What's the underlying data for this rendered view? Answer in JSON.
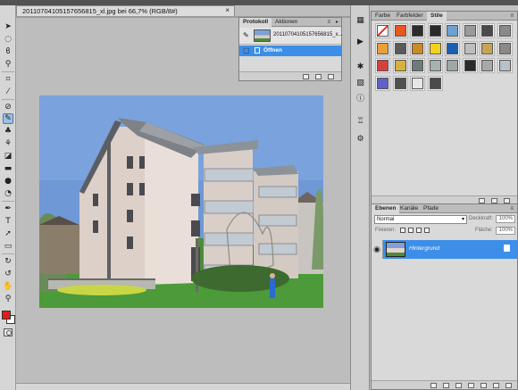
{
  "document": {
    "tab_title": "20110704105157656815_xl.jpg bei 66,7% (RGB/8#)",
    "close_glyph": "×"
  },
  "history_panel": {
    "tabs": [
      "Protokoll",
      "Aktionen"
    ],
    "snapshot_label": "20110704105157656815_x...",
    "state_label": "Öffnen"
  },
  "styles_panel": {
    "tabs": [
      "Farbe",
      "Farbfelder",
      "Stile"
    ],
    "swatch_colors": [
      "#f4f4f4",
      "#e8571e",
      "#2c2c2c",
      "#2a2a2a",
      "#6fa0d2",
      "#9a9a9a",
      "#4a4a4a",
      "#8a8a8a",
      "#e9a03a",
      "#5a5a5a",
      "#c98b25",
      "#f2d21a",
      "#1c5fb1",
      "#bdbdbd",
      "#c7a455",
      "#8a8a8a",
      "#d84040",
      "#d8b040",
      "#6f7a7a",
      "#a6b2b2",
      "#9ea8a8",
      "#2a2a2a",
      "#a8a8a8",
      "#b8c0c8",
      "#6060c8",
      "#505050",
      "#e6e6e6",
      "#4a4a4a"
    ]
  },
  "layers_panel": {
    "tabs": [
      "Ebenen",
      "Kanäle",
      "Pfade"
    ],
    "blend_mode": "Normal",
    "opacity_label": "Deckkraft:",
    "opacity_value": "100%",
    "lock_label": "Fixieren:",
    "fill_label": "Fläche:",
    "fill_value": "100%",
    "layer_name": "Hintergrund"
  },
  "colors": {
    "foreground": "#e31b1b",
    "background": "#ffffff",
    "selection": "#3c8ee8"
  }
}
